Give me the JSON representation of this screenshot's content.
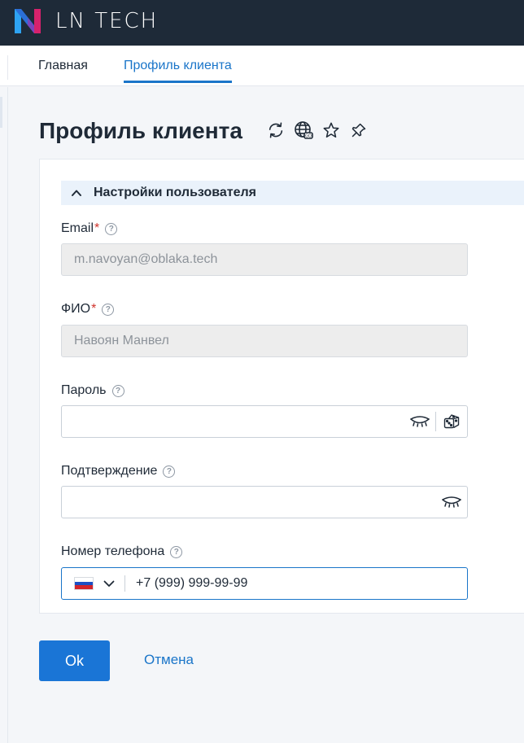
{
  "header": {
    "brand": "LN TECH",
    "colors": {
      "bar": "#1e2a38",
      "logo_a": "#2ea3f2",
      "logo_b": "#d6226c"
    }
  },
  "tabs": [
    {
      "label": "Главная",
      "active": false
    },
    {
      "label": "Профиль клиента",
      "active": true
    }
  ],
  "page": {
    "title": "Профиль клиента",
    "title_icons": [
      "refresh-icon",
      "globe-icon",
      "star-icon",
      "pin-icon"
    ]
  },
  "section": {
    "label": "Настройки пользователя",
    "expanded": true
  },
  "fields": {
    "email": {
      "label": "Email",
      "required": "*",
      "value": "m.navoyan@oblaka.tech",
      "disabled": true
    },
    "fio": {
      "label": "ФИО",
      "required": "*",
      "value": "Навоян Манвел",
      "disabled": true
    },
    "password": {
      "label": "Пароль",
      "value": "",
      "icons": [
        "eye-closed-icon",
        "dice-icon"
      ]
    },
    "confirm": {
      "label": "Подтверждение",
      "value": "",
      "icons": [
        "eye-closed-icon"
      ]
    },
    "phone": {
      "label": "Номер телефона",
      "country": "RU",
      "value": "+7 (999) 999-99-99"
    }
  },
  "help_glyph": "?",
  "actions": {
    "ok": "Ok",
    "cancel": "Отмена"
  },
  "accent": "#1a75c9"
}
